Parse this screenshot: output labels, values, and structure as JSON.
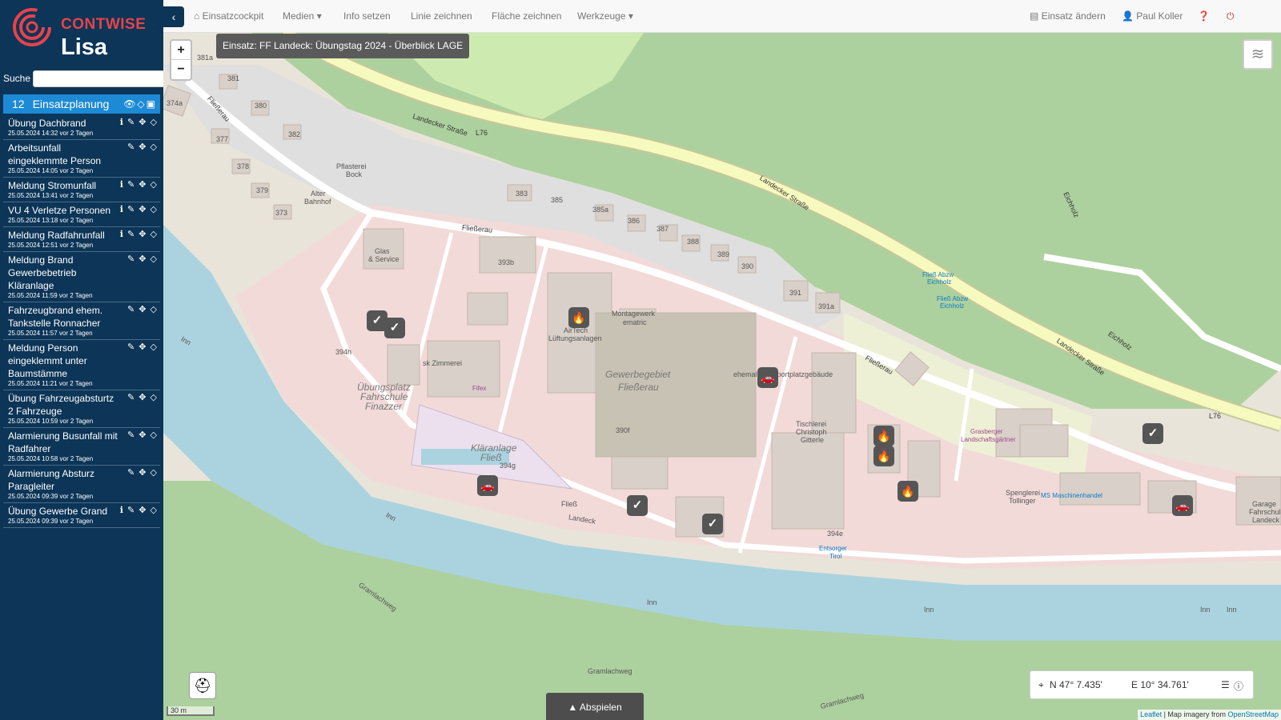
{
  "brand": {
    "name": "CONTWISE",
    "app": "Lisa"
  },
  "sidebar": {
    "search_label": "Suche",
    "search_value": "",
    "group": {
      "count": "12",
      "label": "Einsatzplanung"
    },
    "events": [
      {
        "title": "Übung Dachbrand",
        "date": "25.05.2024 14:32 vor 2 Tagen",
        "tools": "ℹ ✎ ✥ ◇"
      },
      {
        "title": "Arbeitsunfall eingeklemmte Person",
        "date": "25.05.2024 14:05 vor 2 Tagen",
        "tools": "✎ ✥ ◇"
      },
      {
        "title": "Meldung Stromunfall",
        "date": "25.05.2024 13:41 vor 2 Tagen",
        "tools": "ℹ ✎ ✥ ◇"
      },
      {
        "title": "VU 4 Verletze Personen",
        "date": "25.05.2024 13:18 vor 2 Tagen",
        "tools": "ℹ ✎ ✥ ◇"
      },
      {
        "title": "Meldung Radfahrunfall",
        "date": "25.05.2024 12:51 vor 2 Tagen",
        "tools": "ℹ ✎ ✥ ◇"
      },
      {
        "title": "Meldung Brand Gewerbebetrieb Kläranlage",
        "date": "25.05.2024 11:59 vor 2 Tagen",
        "tools": "✎ ✥ ◇"
      },
      {
        "title": "Fahrzeugbrand ehem. Tankstelle Ronnacher",
        "date": "25.05.2024 11:57 vor 2 Tagen",
        "tools": "✎ ✥ ◇"
      },
      {
        "title": "Meldung Person eingeklemmt unter Baumstämme",
        "date": "25.05.2024 11:21 vor 2 Tagen",
        "tools": "✎ ✥ ◇"
      },
      {
        "title": "Übung Fahrzeugabsturtz 2 Fahrzeuge",
        "date": "25.05.2024 10:59 vor 2 Tagen",
        "tools": "✎ ✥ ◇"
      },
      {
        "title": "Alarmierung Busunfall mit Radfahrer",
        "date": "25.05.2024 10:58 vor 2 Tagen",
        "tools": "✎ ✥ ◇"
      },
      {
        "title": "Alarmierung Absturz Paragleiter",
        "date": "25.05.2024 09:39 vor 2 Tagen",
        "tools": "✎ ✥ ◇"
      },
      {
        "title": "Übung Gewerbe Grand",
        "date": "25.05.2024 09:39 vor 2 Tagen",
        "tools": "ℹ ✎ ✥ ◇"
      }
    ]
  },
  "navbar": {
    "cockpit": "Einsatzcockpit",
    "media": "Medien",
    "info": "Info setzen",
    "line": "Linie zeichnen",
    "area": "Fläche zeichnen",
    "tools": "Werkzeuge",
    "change": "Einsatz ändern",
    "user": "Paul Koller"
  },
  "map": {
    "mission_title": "Einsatz: FF Landeck: Übungstag 2024 - Überblick LAGE",
    "zoom_in": "+",
    "zoom_out": "−",
    "coord_n": "N 47° 7.435'",
    "coord_e": "E 10° 34.761'",
    "play": "Abspielen",
    "scale": "30 m",
    "attribution_leaflet": "Leaflet",
    "attribution_rest": " | Map imagery from ",
    "attribution_osm": "OpenStreetMap",
    "labels": {
      "landecker1": "Landecker Straße",
      "l76a": "L76",
      "landecker2": "Landecker Straße",
      "landecker3": "Landecker Straße",
      "l76b": "L76",
      "fliesserau1": "Fließerau",
      "fliesserau2": "Fließerau",
      "fliesserau3": "Fließerau",
      "eichholz1": "Eichholz",
      "eichholz2": "Eichholz",
      "gewerbe1": "Gewerbegebiet",
      "gewerbe2": "Fließerau",
      "pflasterei": "Pflasterei",
      "bock": "Bock",
      "alter": "Alter",
      "bahnhof": "Bahnhof",
      "glas": "Glas",
      "service": "& Service",
      "airtech1": "AirTech",
      "airtech2": "Lüftungsanlagen",
      "montage": "Montagewerk",
      "ematric": "ematric",
      "zimmerei": "sk Zimmerei",
      "fifex": "Fifex",
      "uebung1": "Übungsplatz",
      "uebung2": "Fahrschule",
      "uebung3": "Finazzer",
      "klaer1": "Kläranlage",
      "klaer2": "Fließ",
      "tischlerei1": "Tischlerei",
      "tischlerei2": "Christoph",
      "tischlerei3": "Gitterle",
      "sport": "ehemaliges Sportplatzgebäude",
      "grasberger1": "Grasberger",
      "grasberger2": "Landschaftsgärtner",
      "spengler1": "Spenglerei",
      "spengler2": "Tollinger",
      "ms": "MS Maschinenhandel",
      "entsorger1": "Entsorger",
      "entsorger2": "Tirol",
      "garage1": "Garage",
      "garage2": "Fahrschule",
      "garage3": "Landeck",
      "bus1": "Fließ Abzw",
      "bus2": "Eichholz",
      "bus3": "Fließ Abzw",
      "bus4": "Eichholz",
      "inn1": "Inn",
      "inn2": "Inn",
      "inn3": "Inn",
      "inn4": "Inn",
      "inn5": "Inn",
      "inn6": "Inn",
      "gram1": "Gramlachweg",
      "gram2": "Gramlachweg",
      "gram3": "Gramlachweg",
      "gram4": "Gramlachweg",
      "fliess_small": "Fließ",
      "landeck_small": "Landeck",
      "n381": "381",
      "n381a": "381a",
      "n380": "380",
      "n382": "382",
      "n377": "377",
      "n378": "378",
      "n379": "379",
      "n373": "373",
      "n374a": "374a",
      "n383": "383",
      "n385": "385",
      "n385a": "385a",
      "n386": "386",
      "n387": "387",
      "n388": "388",
      "n389": "389",
      "n390": "390",
      "n391": "391",
      "n391a": "391a",
      "n393b": "393b",
      "n394h": "394h",
      "n394g": "394g",
      "n390f": "390f",
      "n394e": "394e"
    }
  },
  "colors": {
    "sidebar": "#0c3557",
    "group": "#1d8ad6",
    "brand_red": "#e8424b",
    "forest": "#aed1a0",
    "river": "#aad3df",
    "industrial": "#f2dad9",
    "road_primary": "#f7fabf"
  },
  "icons": {
    "home": "home-icon",
    "user": "user-icon",
    "help": "help-icon",
    "power": "power-icon",
    "layers": "layers-icon",
    "crosshair": "crosshair-icon",
    "fire": "fire-icon",
    "check": "check-icon",
    "car": "car-icon"
  }
}
